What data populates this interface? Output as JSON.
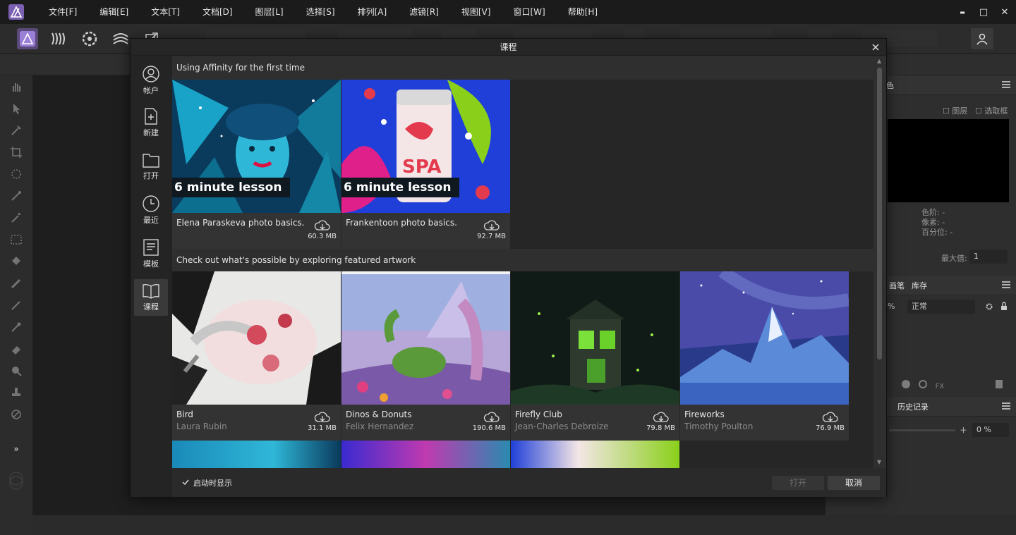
{
  "menu": [
    "文件[F]",
    "编辑[E]",
    "文本[T]",
    "文档[D]",
    "图层[L]",
    "选择[S]",
    "排列[A]",
    "滤镜[R]",
    "视图[V]",
    "窗口[W]",
    "帮助[H]"
  ],
  "window_controls": {
    "minimize": "▬",
    "maximize": "□",
    "close": "✕"
  },
  "colors": {
    "accent": "#5a4a7a",
    "menubar": "#1b1b1b",
    "dialog": "#2a2a2a"
  },
  "right_panel": {
    "tab_top": "色",
    "chk_layers": "图层",
    "chk_selection": "选取框",
    "levels_label": "色阶: -",
    "pixels_label": "像素: -",
    "percentile_label": "百分位: -",
    "max_label": "最大值:",
    "max_value": "1",
    "tab_brush": "画笔",
    "tab_library": "库存",
    "opacity_suffix": "%",
    "blend_mode": "正常",
    "tab_history": "历史记录",
    "zoom_value": "0 %"
  },
  "dialog": {
    "title": "课程",
    "nav": [
      {
        "label": "帐户",
        "icon": "account-icon"
      },
      {
        "label": "新建",
        "icon": "new-document-icon"
      },
      {
        "label": "打开",
        "icon": "folder-icon"
      },
      {
        "label": "最近",
        "icon": "clock-icon"
      },
      {
        "label": "模板",
        "icon": "template-icon"
      },
      {
        "label": "课程",
        "icon": "book-icon"
      }
    ],
    "sections": {
      "lessons_title": "Using Affinity for the first time",
      "featured_title": "Check out what's possible by exploring featured artwork"
    },
    "lessons": [
      {
        "title": "Elena Paraskeva photo basics.",
        "size": "60.3 MB",
        "badge": "6 minute lesson"
      },
      {
        "title": "Frankentoon photo basics.",
        "size": "92.7 MB",
        "badge": "6 minute lesson"
      }
    ],
    "featured": [
      {
        "title": "Bird",
        "author": "Laura Rubin",
        "size": "31.1 MB"
      },
      {
        "title": "Dinos & Donuts",
        "author": "Felix Hernandez",
        "size": "190.6 MB"
      },
      {
        "title": "Firefly Club",
        "author": "Jean-Charles Debroize",
        "size": "79.8 MB"
      },
      {
        "title": "Fireworks",
        "author": "Timothy Poulton",
        "size": "76.9 MB"
      }
    ],
    "footer": {
      "show_on_startup": "启动时显示",
      "show_on_startup_checked": true,
      "open_button": "打开",
      "cancel_button": "取消"
    }
  }
}
